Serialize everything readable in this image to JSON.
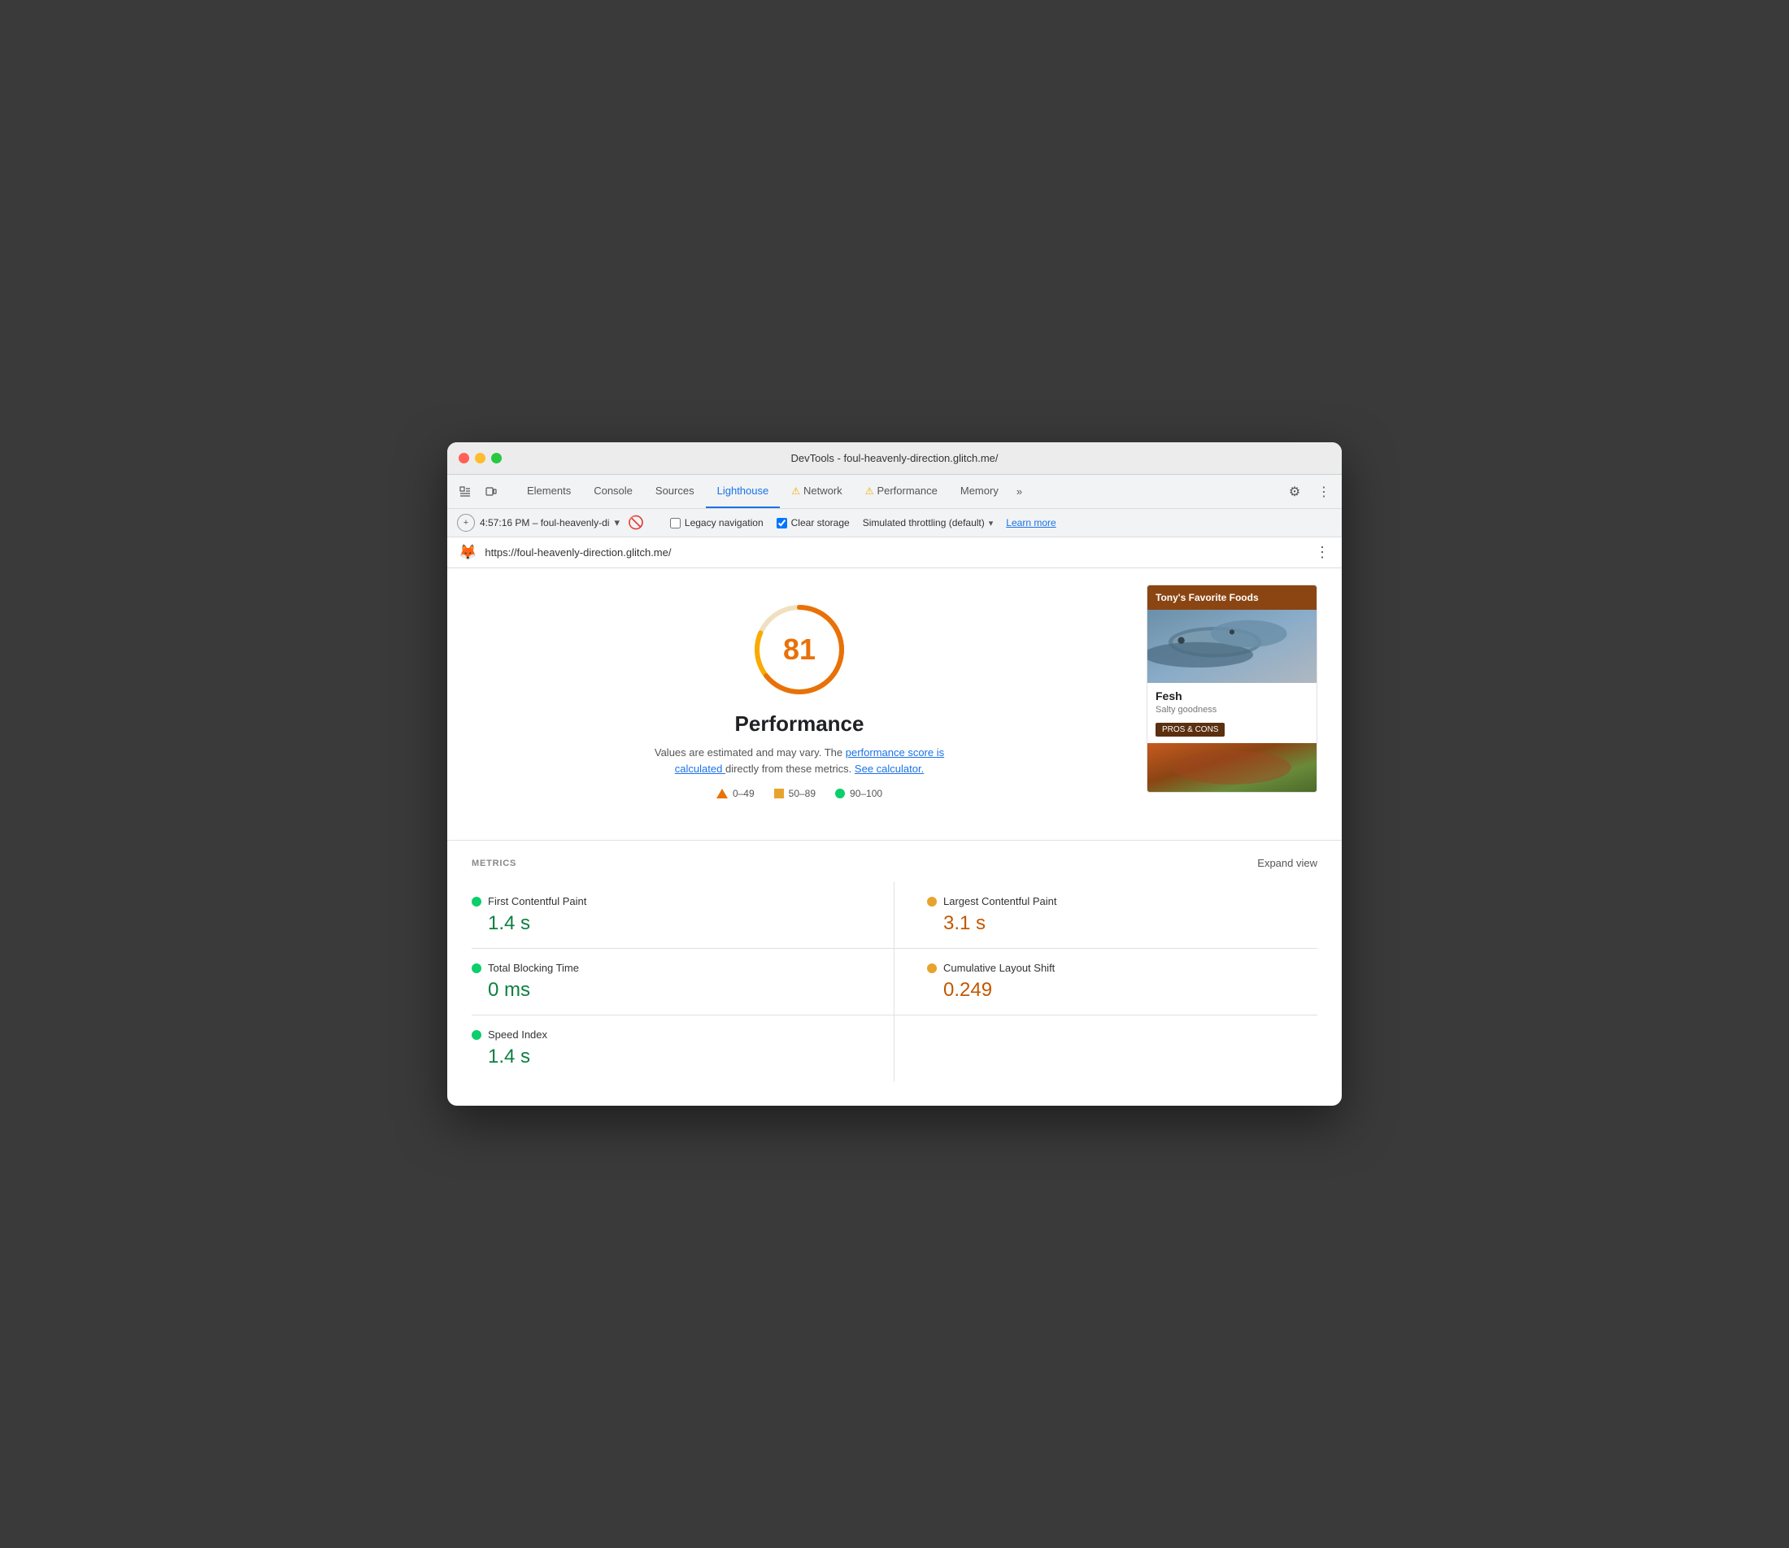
{
  "window": {
    "title": "DevTools - foul-heavenly-direction.glitch.me/"
  },
  "tabs": {
    "items": [
      {
        "label": "Elements",
        "active": false,
        "warning": false
      },
      {
        "label": "Console",
        "active": false,
        "warning": false
      },
      {
        "label": "Sources",
        "active": false,
        "warning": false
      },
      {
        "label": "Lighthouse",
        "active": true,
        "warning": false
      },
      {
        "label": "Network",
        "active": false,
        "warning": true
      },
      {
        "label": "Performance",
        "active": false,
        "warning": true
      },
      {
        "label": "Memory",
        "active": false,
        "warning": false
      }
    ],
    "more_label": "»"
  },
  "toolbar": {
    "timestamp": "4:57:16 PM – foul-heavenly-di",
    "legacy_nav_label": "Legacy navigation",
    "clear_storage_label": "Clear storage",
    "throttling_label": "Simulated throttling (default)",
    "learn_more_label": "Learn more"
  },
  "urlbar": {
    "url": "https://foul-heavenly-direction.glitch.me/"
  },
  "score": {
    "value": "81",
    "title": "Performance",
    "description": "Values are estimated and may vary. The",
    "link1": "performance score is calculated",
    "desc2": "directly from these metrics.",
    "link2": "See calculator.",
    "legend": {
      "low": "0–49",
      "medium": "50–89",
      "high": "90–100"
    }
  },
  "preview": {
    "header": "Tony's Favorite Foods",
    "food_name": "Fesh",
    "food_desc": "Salty goodness",
    "food_btn": "PROS & CONS"
  },
  "metrics": {
    "section_label": "METRICS",
    "expand_label": "Expand view",
    "items": [
      {
        "name": "First Contentful Paint",
        "value": "1.4 s",
        "status": "green",
        "position": "left"
      },
      {
        "name": "Largest Contentful Paint",
        "value": "3.1 s",
        "status": "orange",
        "position": "right"
      },
      {
        "name": "Total Blocking Time",
        "value": "0 ms",
        "status": "green",
        "position": "left"
      },
      {
        "name": "Cumulative Layout Shift",
        "value": "0.249",
        "status": "orange",
        "position": "right"
      },
      {
        "name": "Speed Index",
        "value": "1.4 s",
        "status": "green",
        "position": "left",
        "last": true
      }
    ]
  }
}
